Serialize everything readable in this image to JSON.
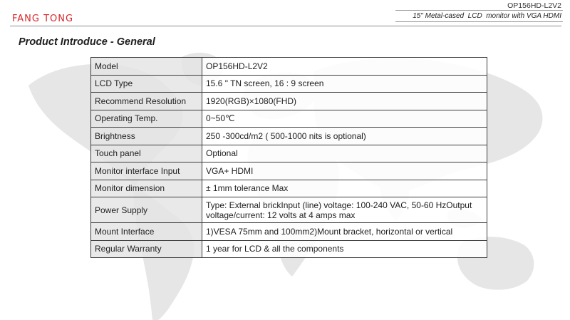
{
  "header": {
    "brand": "FANG TONG",
    "model": "OP156HD-L2V2",
    "subtitle": "15\" Metal-cased  LCD  monitor with VGA HDMI",
    "brand_color": "#d9262a"
  },
  "page_title": "Product Introduce - General",
  "specs": [
    {
      "label": "Model",
      "value": "OP156HD-L2V2"
    },
    {
      "label": "LCD Type",
      "value": "15.6 \" TN screen, 16 : 9 screen"
    },
    {
      "label": "Recommend Resolution",
      "value": "1920(RGB)×1080(FHD)"
    },
    {
      "label": "Operating Temp.",
      "value": "0~50℃"
    },
    {
      "label": "Brightness",
      "value": "250 -300cd/m2 ( 500-1000 nits is optional)"
    },
    {
      "label": "Touch panel",
      "value": "Optional"
    },
    {
      "label": "Monitor interface Input",
      "value": "VGA+ HDMI"
    },
    {
      "label": "Monitor dimension",
      "value": "± 1mm tolerance Max"
    },
    {
      "label": "Power Supply",
      "value": "Type: External brickInput (line) voltage: 100-240 VAC, 50-60 HzOutput voltage/current: 12 volts at 4 amps max"
    },
    {
      "label": "Mount Interface",
      "value": "1)VESA 75mm and 100mm2)Mount bracket, horizontal or vertical"
    },
    {
      "label": "Regular Warranty",
      "value": "1 year for LCD & all the components"
    }
  ]
}
